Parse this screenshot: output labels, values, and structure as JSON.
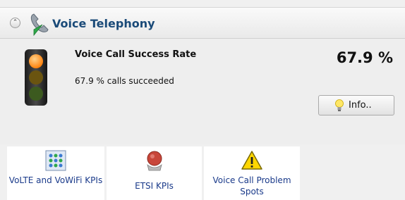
{
  "header": {
    "title": "Voice Telephony",
    "collapse_icon": "double-chevron-up-icon",
    "section_icon": "telephone-receiver-icon"
  },
  "kpi": {
    "status_icon": "traffic-light-icon",
    "title": "Voice Call Success Rate",
    "subtitle": "67.9 % calls succeeded",
    "value": "67.9 %",
    "info_button": {
      "label": "Info..",
      "icon": "light-bulb-icon"
    }
  },
  "tiles": [
    {
      "label": "VoLTE and VoWiFi KPIs",
      "icon": "grid-icon"
    },
    {
      "label": "ETSI KPIs",
      "icon": "etsi-logo-icon"
    },
    {
      "label": "Voice Call Problem Spots",
      "icon": "warning-icon"
    }
  ],
  "colors": {
    "title_blue": "#1a4a78",
    "link_blue": "#1a3a8a",
    "traffic_light_lit": "#ff8c1a",
    "warning_yellow": "#ffd600"
  }
}
